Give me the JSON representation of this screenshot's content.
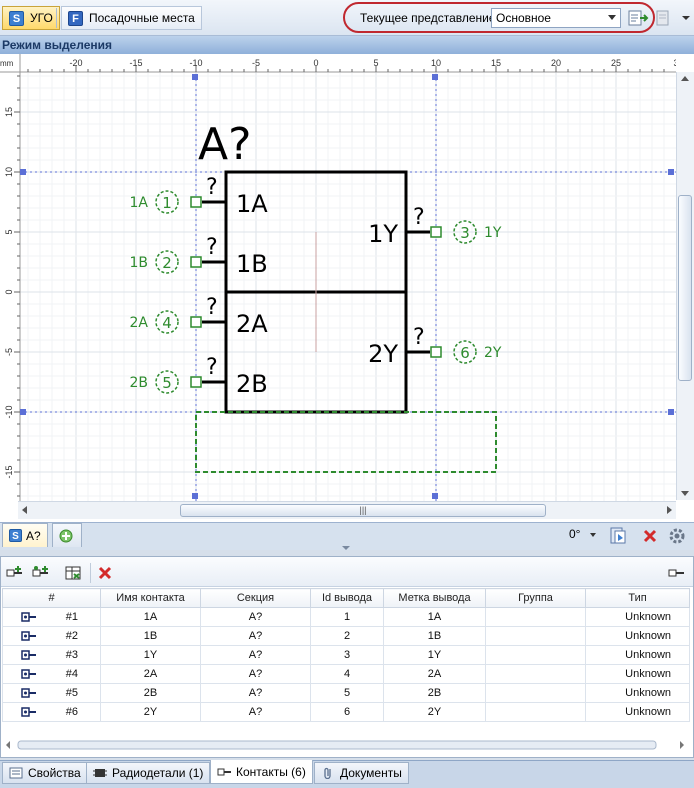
{
  "toolbar": {
    "ugo_label": "УГО",
    "footprints_label": "Посадочные места",
    "view_label": "Текущее представление",
    "view_value": "Основное"
  },
  "mode_title": "Режим выделения",
  "ruler": {
    "mm_label": "mm",
    "x_ticks": [
      "-20",
      "-15",
      "-10",
      "-5",
      "0",
      "5",
      "10",
      "15",
      "20",
      "25",
      "3"
    ],
    "y_ticks": [
      "15",
      "10",
      "5",
      "0",
      "-5",
      "-10",
      "-15"
    ]
  },
  "symbol": {
    "refdes": "A?",
    "sections": [
      {
        "left": [
          {
            "name": "1A",
            "pin": "1",
            "label": "1A"
          },
          {
            "name": "1B",
            "pin": "2",
            "label": "1B"
          }
        ],
        "right": {
          "name": "1Y",
          "pin": "3",
          "label": "1Y"
        }
      },
      {
        "left": [
          {
            "name": "2A",
            "pin": "4",
            "label": "2A"
          },
          {
            "name": "2B",
            "pin": "5",
            "label": "2B"
          }
        ],
        "right": {
          "name": "2Y",
          "pin": "6",
          "label": "2Y"
        }
      }
    ],
    "unknown_mark": "?"
  },
  "panel": {
    "tab_label": "A?",
    "rotation": "0°",
    "columns": [
      "#",
      "Имя контакта",
      "Секция",
      "Id вывода",
      "Метка вывода",
      "Группа",
      "Тип"
    ],
    "rows": [
      {
        "num": "#1",
        "name": "1A",
        "section": "A?",
        "id": "1",
        "label": "1A",
        "group": "",
        "type": "Unknown"
      },
      {
        "num": "#2",
        "name": "1B",
        "section": "A?",
        "id": "2",
        "label": "1B",
        "group": "",
        "type": "Unknown"
      },
      {
        "num": "#3",
        "name": "1Y",
        "section": "A?",
        "id": "3",
        "label": "1Y",
        "group": "",
        "type": "Unknown"
      },
      {
        "num": "#4",
        "name": "2A",
        "section": "A?",
        "id": "4",
        "label": "2A",
        "group": "",
        "type": "Unknown"
      },
      {
        "num": "#5",
        "name": "2B",
        "section": "A?",
        "id": "5",
        "label": "2B",
        "group": "",
        "type": "Unknown"
      },
      {
        "num": "#6",
        "name": "2Y",
        "section": "A?",
        "id": "6",
        "label": "2Y",
        "group": "",
        "type": "Unknown"
      }
    ]
  },
  "bottom_tabs": {
    "properties": "Свойства",
    "components": "Радиодетали (1)",
    "contacts": "Контакты (6)",
    "documents": "Документы"
  },
  "colors": {
    "accent": "#3d7fd1",
    "green": "#2e8b2e",
    "highlight": "#c0282f"
  }
}
